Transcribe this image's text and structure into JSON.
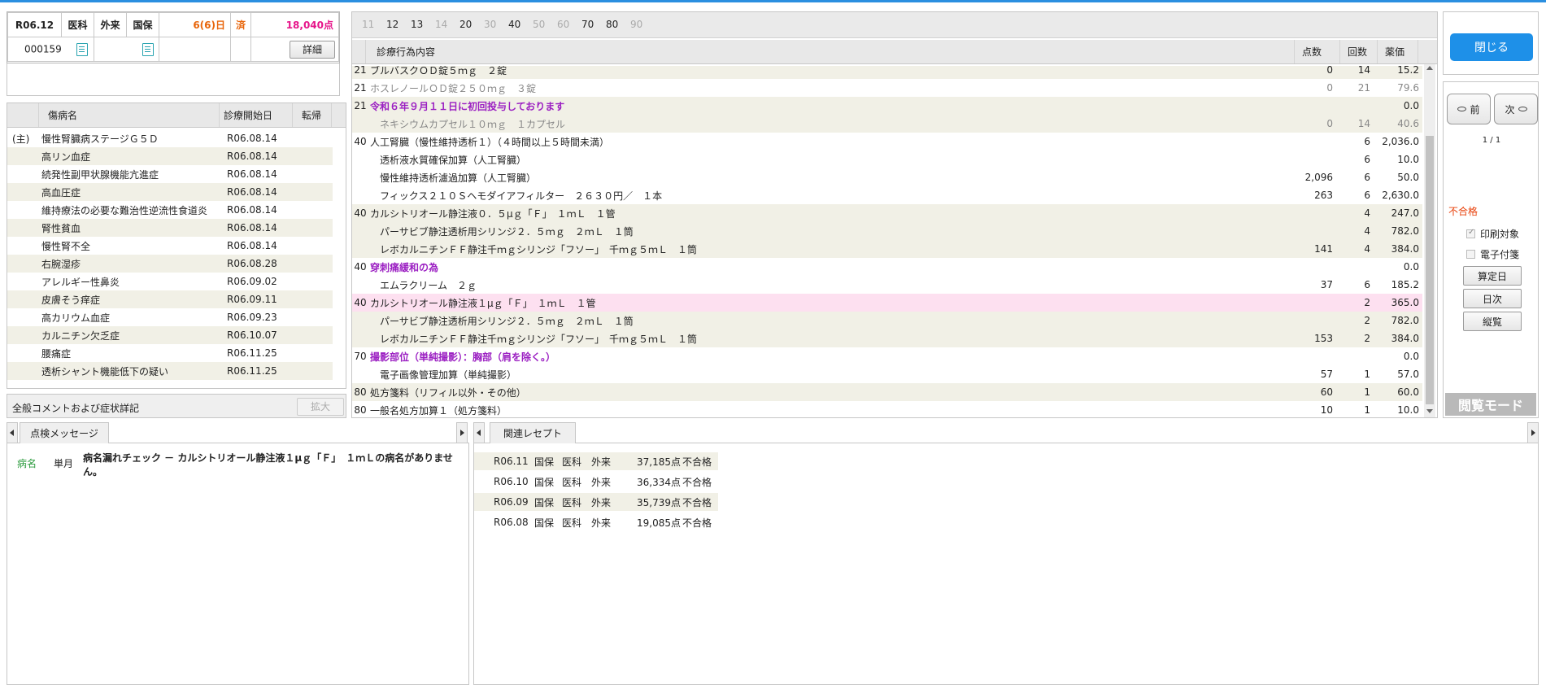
{
  "header": {
    "date": "R06.12",
    "type1": "医科",
    "type2": "外来",
    "insurance": "国保",
    "days": "6(6)日",
    "status": "済",
    "points": "18,040点",
    "patient_id": "000159",
    "detail_label": "詳細"
  },
  "disease": {
    "columns": [
      "傷病名",
      "診療開始日",
      "転帰"
    ],
    "rows": [
      {
        "prefix": "(主)",
        "name": "慢性腎臓病ステージＧ５Ｄ",
        "date": "R06.08.14",
        "outcome": ""
      },
      {
        "prefix": "",
        "name": "高リン血症",
        "date": "R06.08.14",
        "outcome": ""
      },
      {
        "prefix": "",
        "name": "続発性副甲状腺機能亢進症",
        "date": "R06.08.14",
        "outcome": ""
      },
      {
        "prefix": "",
        "name": "高血圧症",
        "date": "R06.08.14",
        "outcome": ""
      },
      {
        "prefix": "",
        "name": "維持療法の必要な難治性逆流性食道炎",
        "date": "R06.08.14",
        "outcome": ""
      },
      {
        "prefix": "",
        "name": "腎性貧血",
        "date": "R06.08.14",
        "outcome": ""
      },
      {
        "prefix": "",
        "name": "慢性腎不全",
        "date": "R06.08.14",
        "outcome": ""
      },
      {
        "prefix": "",
        "name": "右腕湿疹",
        "date": "R06.08.28",
        "outcome": ""
      },
      {
        "prefix": "",
        "name": "アレルギー性鼻炎",
        "date": "R06.09.02",
        "outcome": ""
      },
      {
        "prefix": "",
        "name": "皮膚そう痒症",
        "date": "R06.09.11",
        "outcome": ""
      },
      {
        "prefix": "",
        "name": "高カリウム血症",
        "date": "R06.09.23",
        "outcome": ""
      },
      {
        "prefix": "",
        "name": "カルニチン欠乏症",
        "date": "R06.10.07",
        "outcome": ""
      },
      {
        "prefix": "",
        "name": "腰痛症",
        "date": "R06.11.25",
        "outcome": ""
      },
      {
        "prefix": "",
        "name": "透析シャント機能低下の疑い",
        "date": "R06.11.25",
        "outcome": ""
      }
    ],
    "comment_label": "全般コメントおよび症状詳記",
    "expand_label": "拡大"
  },
  "tabs": [
    {
      "label": "11",
      "enabled": false
    },
    {
      "label": "12",
      "enabled": true
    },
    {
      "label": "13",
      "enabled": true
    },
    {
      "label": "14",
      "enabled": false
    },
    {
      "label": "20",
      "enabled": true
    },
    {
      "label": "30",
      "enabled": false
    },
    {
      "label": "40",
      "enabled": true
    },
    {
      "label": "50",
      "enabled": false
    },
    {
      "label": "60",
      "enabled": false
    },
    {
      "label": "70",
      "enabled": true
    },
    {
      "label": "80",
      "enabled": true
    },
    {
      "label": "90",
      "enabled": false
    }
  ],
  "treatment": {
    "columns": [
      "診療行為内容",
      "点数",
      "回数",
      "薬価"
    ],
    "rows": [
      {
        "code": "21",
        "content": "ブルバスクＯＤ錠５ｍｇ　２錠",
        "points": "0",
        "count": "14",
        "price": "15.2",
        "style": "gray-partial",
        "bg": "alt"
      },
      {
        "code": "21",
        "content": "ホスレノールＯＤ錠２５０ｍｇ　３錠",
        "points": "0",
        "count": "21",
        "price": "79.6",
        "style": "gray",
        "bg": ""
      },
      {
        "code": "21",
        "content": "令和６年９月１１日に初回投与しております",
        "points": "",
        "count": "",
        "price": "0.0",
        "style": "purple",
        "bg": "alt"
      },
      {
        "code": "",
        "content": "　ネキシウムカプセル１０ｍｇ　１カプセル",
        "points": "0",
        "count": "14",
        "price": "40.6",
        "style": "gray",
        "bg": "alt"
      },
      {
        "code": "40",
        "content": "人工腎臓（慢性維持透析１）（４時間以上５時間未満）",
        "points": "",
        "count": "6",
        "price": "2,036.0",
        "style": "",
        "bg": ""
      },
      {
        "code": "",
        "content": "　透析液水質確保加算（人工腎臓）",
        "points": "",
        "count": "6",
        "price": "10.0",
        "style": "",
        "bg": ""
      },
      {
        "code": "",
        "content": "　慢性維持透析濾過加算（人工腎臓）",
        "points": "2,096",
        "count": "6",
        "price": "50.0",
        "style": "",
        "bg": ""
      },
      {
        "code": "",
        "content": "　フィックス２１０Ｓヘモダイアフィルター　２６３０円／　１本",
        "points": "263",
        "count": "6",
        "price": "2,630.0",
        "style": "",
        "bg": ""
      },
      {
        "code": "40",
        "content": "カルシトリオール静注液０．５μｇ「Ｆ」　１ｍＬ　１管",
        "points": "",
        "count": "4",
        "price": "247.0",
        "style": "",
        "bg": "alt"
      },
      {
        "code": "",
        "content": "　パーサビブ静注透析用シリンジ２．５ｍｇ　２ｍＬ　１筒",
        "points": "",
        "count": "4",
        "price": "782.0",
        "style": "",
        "bg": "alt"
      },
      {
        "code": "",
        "content": "　レボカルニチンＦＦ静注千ｍｇシリンジ「フソー」　千ｍｇ５ｍＬ　１筒",
        "points": "141",
        "count": "4",
        "price": "384.0",
        "style": "",
        "bg": "alt"
      },
      {
        "code": "40",
        "content": "穿刺痛緩和の為",
        "points": "",
        "count": "",
        "price": "0.0",
        "style": "purple",
        "bg": ""
      },
      {
        "code": "",
        "content": "　エムラクリーム　２ｇ",
        "points": "37",
        "count": "6",
        "price": "185.2",
        "style": "",
        "bg": ""
      },
      {
        "code": "40",
        "content": "カルシトリオール静注液１μｇ「Ｆ」　１ｍＬ　１管",
        "points": "",
        "count": "2",
        "price": "365.0",
        "style": "",
        "bg": "sel"
      },
      {
        "code": "",
        "content": "　パーサビブ静注透析用シリンジ２．５ｍｇ　２ｍＬ　１筒",
        "points": "",
        "count": "2",
        "price": "782.0",
        "style": "",
        "bg": "alt"
      },
      {
        "code": "",
        "content": "　レボカルニチンＦＦ静注千ｍｇシリンジ「フソー」　千ｍｇ５ｍＬ　１筒",
        "points": "153",
        "count": "2",
        "price": "384.0",
        "style": "",
        "bg": "alt"
      },
      {
        "code": "70",
        "content": "撮影部位（単純撮影）：胸部（肩を除く。）",
        "points": "",
        "count": "",
        "price": "0.0",
        "style": "purple",
        "bg": ""
      },
      {
        "code": "",
        "content": "　電子画像管理加算（単純撮影）",
        "points": "57",
        "count": "1",
        "price": "57.0",
        "style": "",
        "bg": ""
      },
      {
        "code": "80",
        "content": "処方箋料（リフィル以外・その他）",
        "points": "60",
        "count": "1",
        "price": "60.0",
        "style": "",
        "bg": "alt"
      },
      {
        "code": "80",
        "content": "一般名処方加算１（処方箋料）",
        "points": "10",
        "count": "1",
        "price": "10.0",
        "style": "",
        "bg": ""
      }
    ]
  },
  "right_panel": {
    "close_label": "閉じる",
    "prev_label": "前",
    "next_label": "次",
    "page": "1 / 1",
    "status": "不合格",
    "print_target_label": "印刷対象",
    "attachment_label": "電子付箋",
    "calc_date_label": "算定日",
    "daily_label": "日次",
    "overview_label": "縦覧",
    "mode_label": "閲覧モード"
  },
  "check_messages": {
    "tab_label": "点検メッセージ",
    "items": [
      {
        "category": "病名",
        "period": "単月",
        "text": "病名漏れチェック － カルシトリオール静注液１μｇ「Ｆ」　１ｍＬの病名がありません。"
      }
    ]
  },
  "related_receipts": {
    "tab_label": "関連レセプト",
    "rows": [
      {
        "date": "R06.11",
        "ins": "国保",
        "type": "医科",
        "visit": "外来",
        "points": "37,185点",
        "result": "不合格"
      },
      {
        "date": "R06.10",
        "ins": "国保",
        "type": "医科",
        "visit": "外来",
        "points": "36,334点",
        "result": "不合格"
      },
      {
        "date": "R06.09",
        "ins": "国保",
        "type": "医科",
        "visit": "外来",
        "points": "35,739点",
        "result": "不合格"
      },
      {
        "date": "R06.08",
        "ins": "国保",
        "type": "医科",
        "visit": "外来",
        "points": "19,085点",
        "result": "不合格"
      }
    ]
  },
  "colors": {
    "accent": "#1e90e8",
    "purple": "#9b1fc2",
    "orange": "#e8650a",
    "pink": "#e6158a",
    "fail": "#e8400a",
    "alt_row": "#f1f0e6",
    "selected_row": "#fde0f0"
  }
}
